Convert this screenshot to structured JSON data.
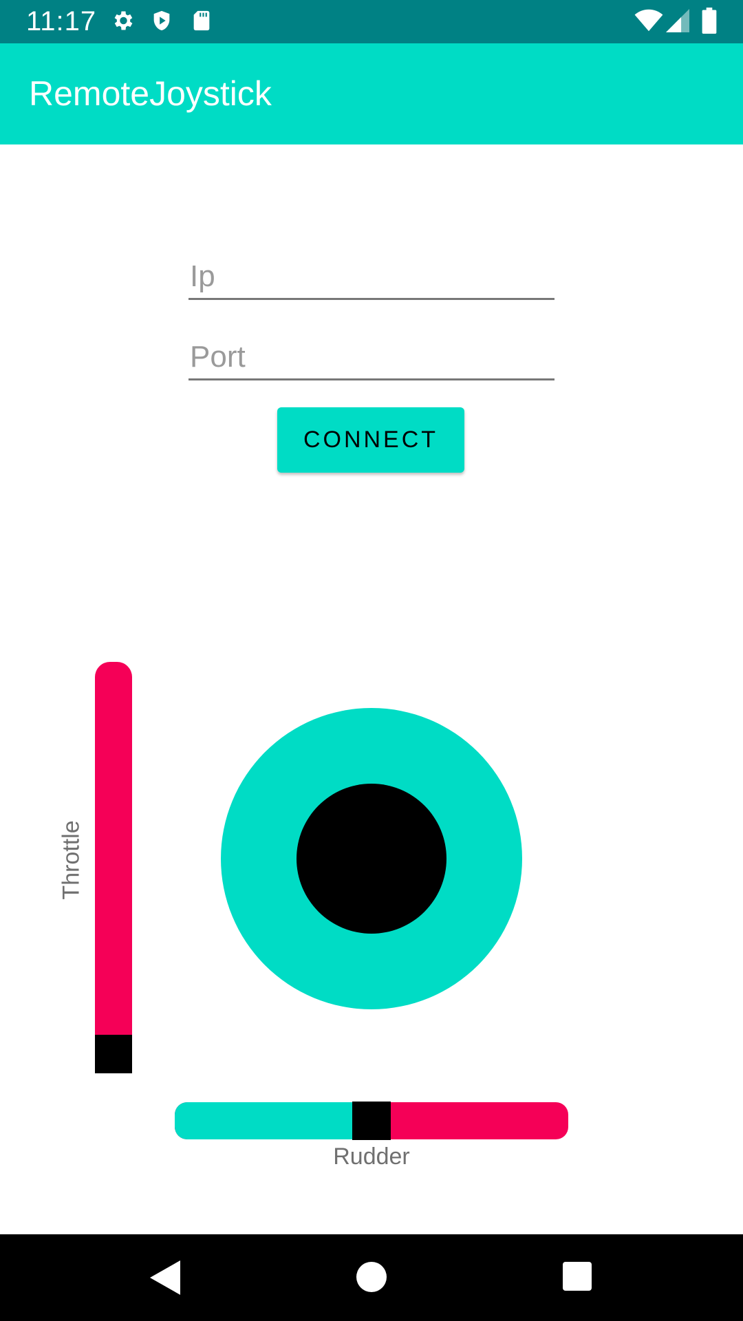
{
  "status_bar": {
    "time": "11:17",
    "icons_left": [
      "gear-icon",
      "shield-play-icon",
      "sd-card-icon"
    ],
    "icons_right": [
      "wifi-icon",
      "cell-signal-icon",
      "battery-icon"
    ],
    "background": "#008184"
  },
  "app_bar": {
    "title": "RemoteJoystick",
    "background": "#00dcc5"
  },
  "form": {
    "ip_placeholder": "Ip",
    "ip_value": "",
    "port_placeholder": "Port",
    "port_value": "",
    "connect_label": "CONNECT"
  },
  "controls": {
    "throttle_label": "Throttle",
    "throttle_value": 0.0,
    "rudder_label": "Rudder",
    "rudder_value": 0.5,
    "joystick_x": 0.0,
    "joystick_y": 0.0,
    "accent": "#00dcc5",
    "secondary": "#f50057"
  },
  "nav_bar": {
    "buttons": [
      "back-icon",
      "home-icon",
      "recents-icon"
    ]
  }
}
